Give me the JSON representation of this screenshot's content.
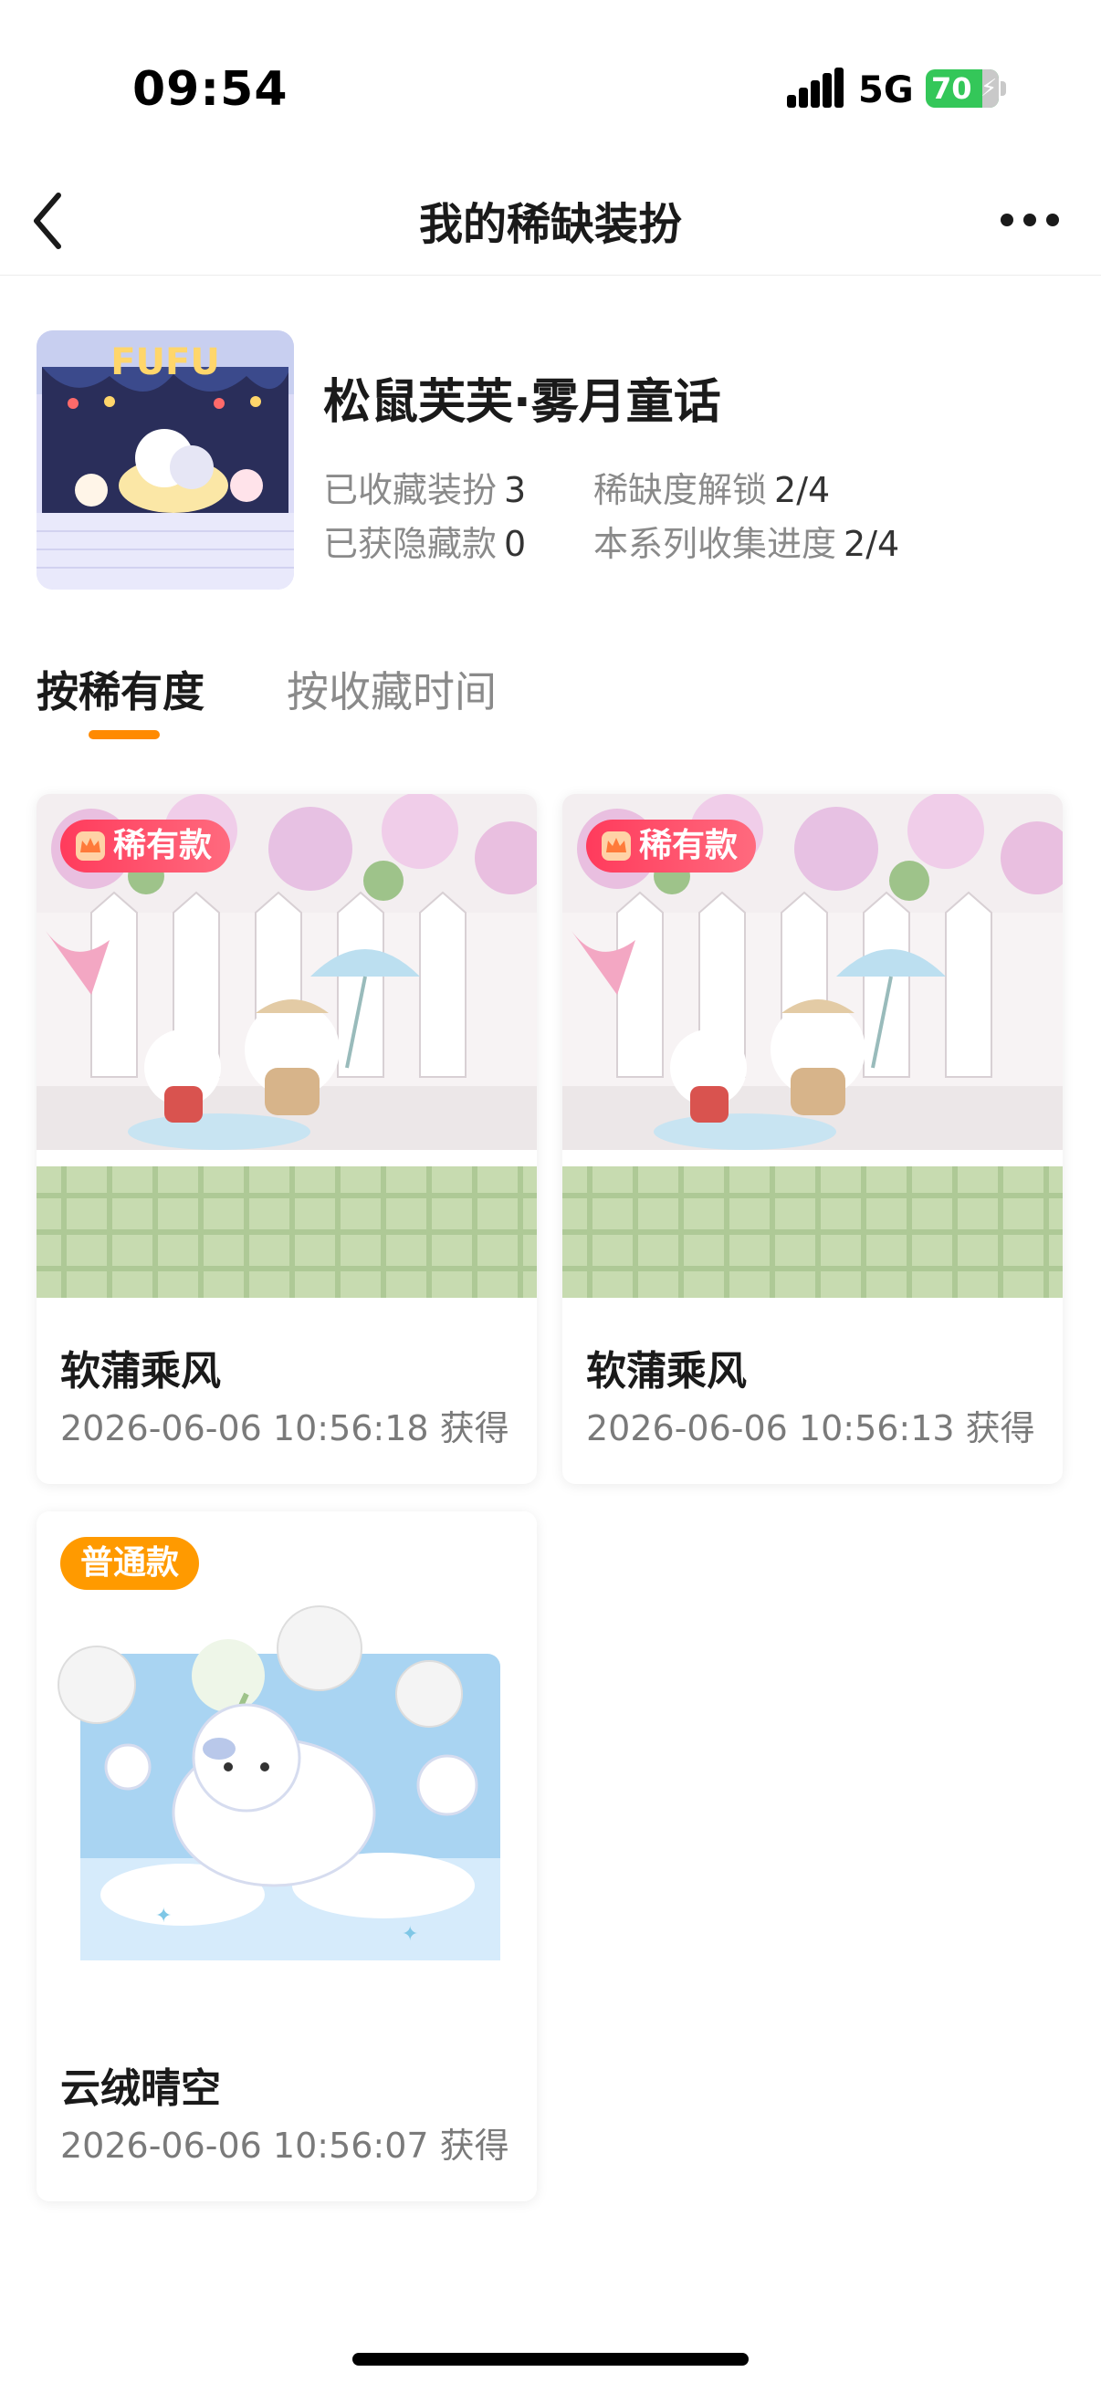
{
  "status_bar": {
    "time": "09:54",
    "network": "5G",
    "battery": "70"
  },
  "nav": {
    "title": "我的稀缺装扮"
  },
  "series": {
    "name": "松鼠芙芙·雾月童话",
    "stats": [
      {
        "label": "已收藏装扮",
        "value": "3"
      },
      {
        "label": "稀缺度解锁",
        "value": "2/4"
      },
      {
        "label": "已获隐藏款",
        "value": "0"
      },
      {
        "label": "本系列收集进度",
        "value": "2/4"
      }
    ]
  },
  "tabs": [
    {
      "label": "按稀有度"
    },
    {
      "label": "按收藏时间"
    }
  ],
  "items": [
    {
      "badge": "稀有款",
      "name": "软蒲乘风",
      "time": "2026-06-06 10:56:18 获得"
    },
    {
      "badge": "稀有款",
      "name": "软蒲乘风",
      "time": "2026-06-06 10:56:13 获得"
    },
    {
      "badge": "普通款",
      "name": "云绒晴空",
      "time": "2026-06-06 10:56:07 获得"
    }
  ],
  "colors": {
    "accent": "#ff8a00",
    "rare_badge": "#ff3b5c",
    "normal_badge": "#ff9a00",
    "battery": "#34c759"
  }
}
